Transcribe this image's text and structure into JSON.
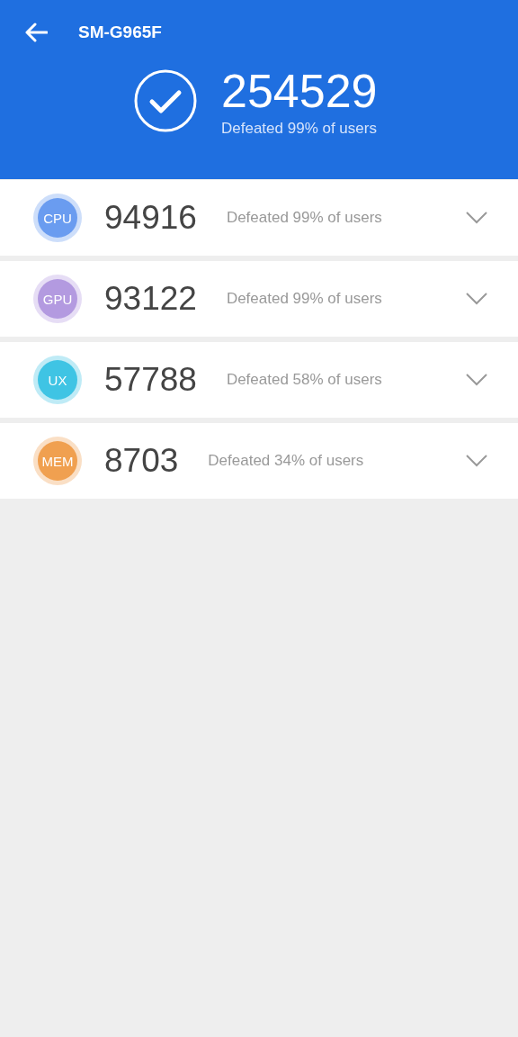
{
  "header": {
    "title": "SM-G965F",
    "total_score": "254529",
    "summary": "Defeated 99% of users"
  },
  "categories": [
    {
      "label": "CPU",
      "score": "94916",
      "summary": "Defeated 99% of users",
      "color": "#6a9cf0",
      "expanded": false
    },
    {
      "label": "GPU",
      "score": "93122",
      "summary": "Defeated 99% of users",
      "color": "#b39ae0",
      "expanded": false
    },
    {
      "label": "UX",
      "score": "57788",
      "summary": "Defeated 58% of users",
      "color": "#3fc4e4",
      "expanded": false
    },
    {
      "label": "MEM",
      "score": "8703",
      "summary": "Defeated 34% of users",
      "color": "#f0a050",
      "expanded": false
    }
  ]
}
